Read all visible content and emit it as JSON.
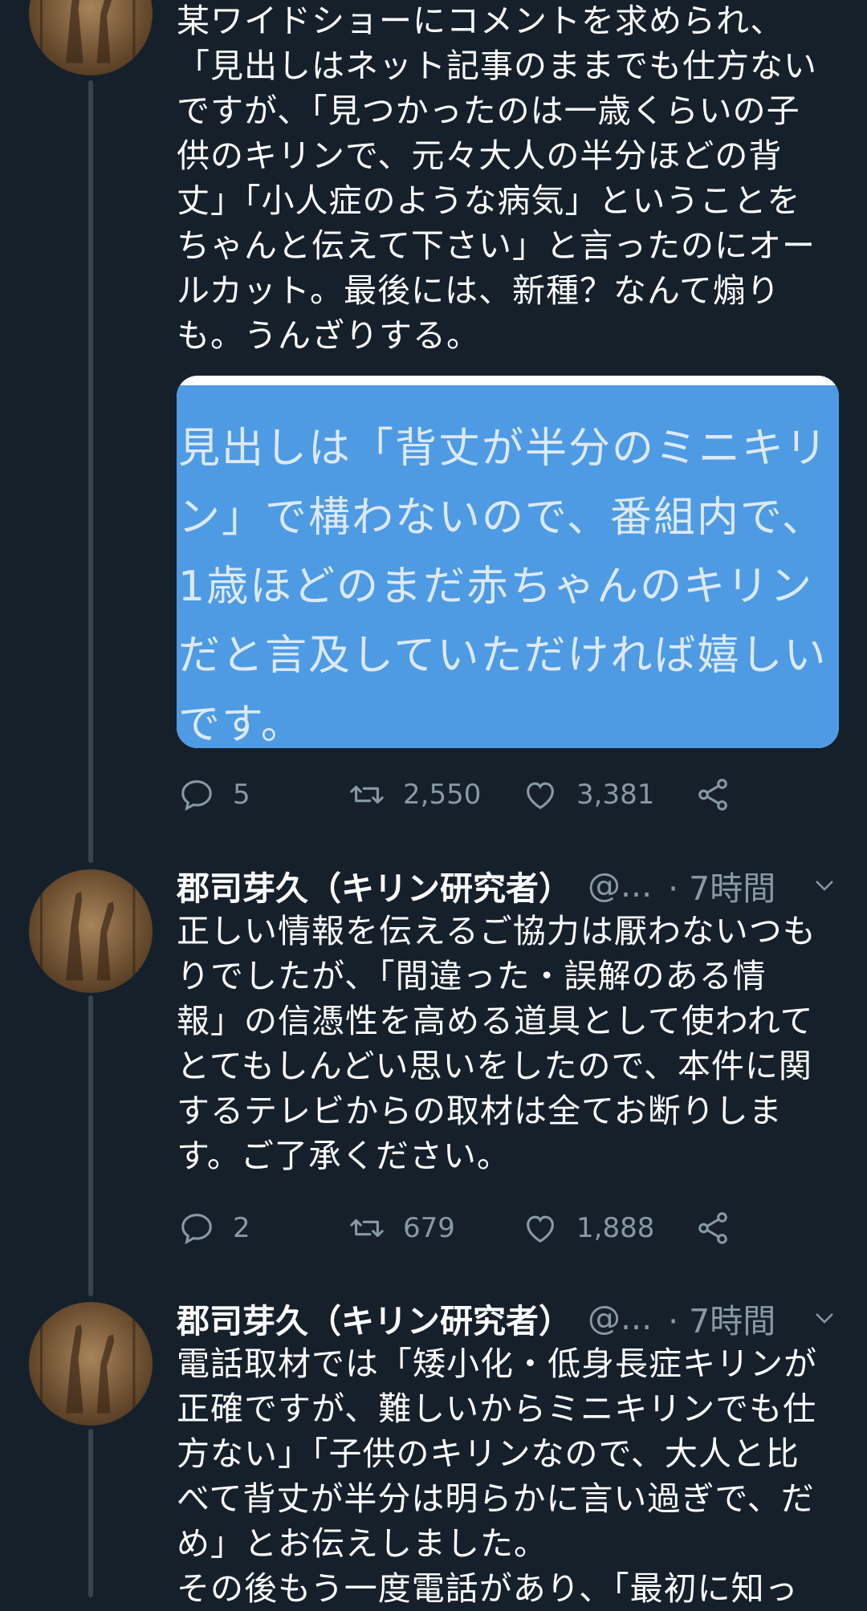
{
  "tweet1": {
    "text": "某ワイドショーにコメントを求められ、\n「見出しはネット記事のままでも仕方ない\nですが、「見つかったのは一歳くらいの子\n供のキリンで、元々大人の半分ほどの背\n丈」「小人症のような病気」ということを\nちゃんと伝えて下さい」と言ったのにオー\nルカット。最後には、新種？なんて煽り\nも。うんざりする。",
    "media_text": "見出しは「背丈が半分のミニキリ\nン」で構わないので、番組内で、\n1歳ほどのまだ赤ちゃんのキリン\nだと言及していただければ嬉しい\nです。",
    "reply_count": "5",
    "retweet_count": "2,550",
    "like_count": "3,381"
  },
  "tweet2": {
    "name": "郡司芽久（キリン研究者）",
    "handle": "@...",
    "time": "· 7時間",
    "text": "正しい情報を伝えるご協力は厭わないつも\nりでしたが、「間違った・誤解のある情\n報」の信憑性を高める道具として使われて\nとてもしんどい思いをしたので、本件に関\nするテレビからの取材は全てお断りしま\nす。ご了承ください。",
    "reply_count": "2",
    "retweet_count": "679",
    "like_count": "1,888"
  },
  "tweet3": {
    "name": "郡司芽久（キリン研究者）",
    "handle": "@...",
    "time": "· 7時間",
    "text": "電話取材では「矮小化・低身長症キリンが\n正確ですが、難しいからミニキリンでも仕\n方ない」「子供のキリンなので、大人と比\nべて背丈が半分は明らかに言い過ぎで、だ\nめ」とお伝えしました。\nその後もう一度電話があり、「最初に知っ"
  },
  "icons": [
    "avatar",
    "reply-icon",
    "retweet-icon",
    "like-icon",
    "share-icon",
    "chevron-down-icon"
  ],
  "colors": {
    "background": "#15202b",
    "text": "#ffffff",
    "secondary": "#8899a6",
    "media": "#4e9be4",
    "thread_line": "#38444d"
  }
}
